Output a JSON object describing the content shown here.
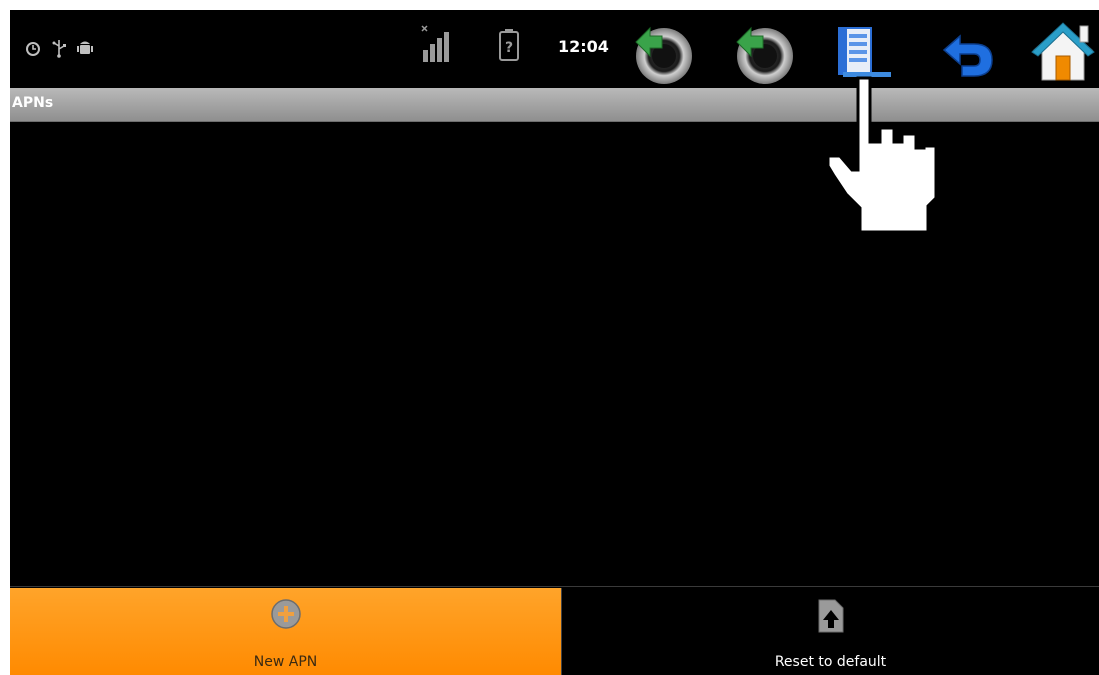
{
  "status_bar": {
    "time": "12:04",
    "left_icons": [
      "clock-alarm-icon",
      "usb-icon",
      "android-debug-icon"
    ],
    "right_icons": [
      "signal-icon",
      "battery-unknown-icon",
      "volume-down-icon",
      "volume-up-icon",
      "screenshot-icon",
      "back-icon",
      "home-icon"
    ]
  },
  "title_bar": {
    "title": "APNs"
  },
  "bottom_bar": {
    "new_apn_label": "New APN",
    "reset_label": "Reset to default"
  },
  "colors": {
    "accent_orange": "#ff9a1a",
    "title_bar_gray": "#a6a6a6",
    "back_blue": "#1f6fe0",
    "home_orange": "#f08a00"
  }
}
